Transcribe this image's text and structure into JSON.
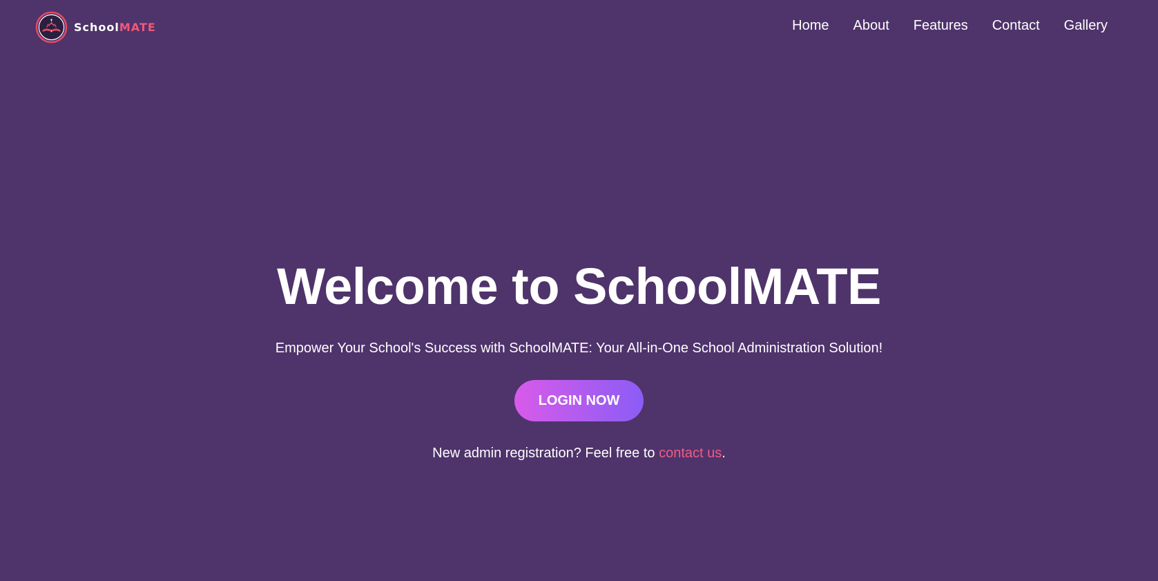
{
  "brand": {
    "name_part1": "School",
    "name_part2": "MATE",
    "logo_icon": "open-book-circle-logo",
    "colors": {
      "background": "#4f336b",
      "accent": "#f0587a",
      "button_gradient_start": "#d85be9",
      "button_gradient_end": "#8b5cf6"
    }
  },
  "nav": {
    "items": [
      {
        "label": "Home"
      },
      {
        "label": "About"
      },
      {
        "label": "Features"
      },
      {
        "label": "Contact"
      },
      {
        "label": "Gallery"
      }
    ]
  },
  "hero": {
    "title": "Welcome to SchoolMATE",
    "subtitle": "Empower Your School's Success with SchoolMATE: Your All-in-One School Administration Solution!",
    "login_label": "LOGIN NOW",
    "note_prefix": "New admin registration? Feel free to ",
    "note_link": "contact us",
    "note_suffix": "."
  }
}
